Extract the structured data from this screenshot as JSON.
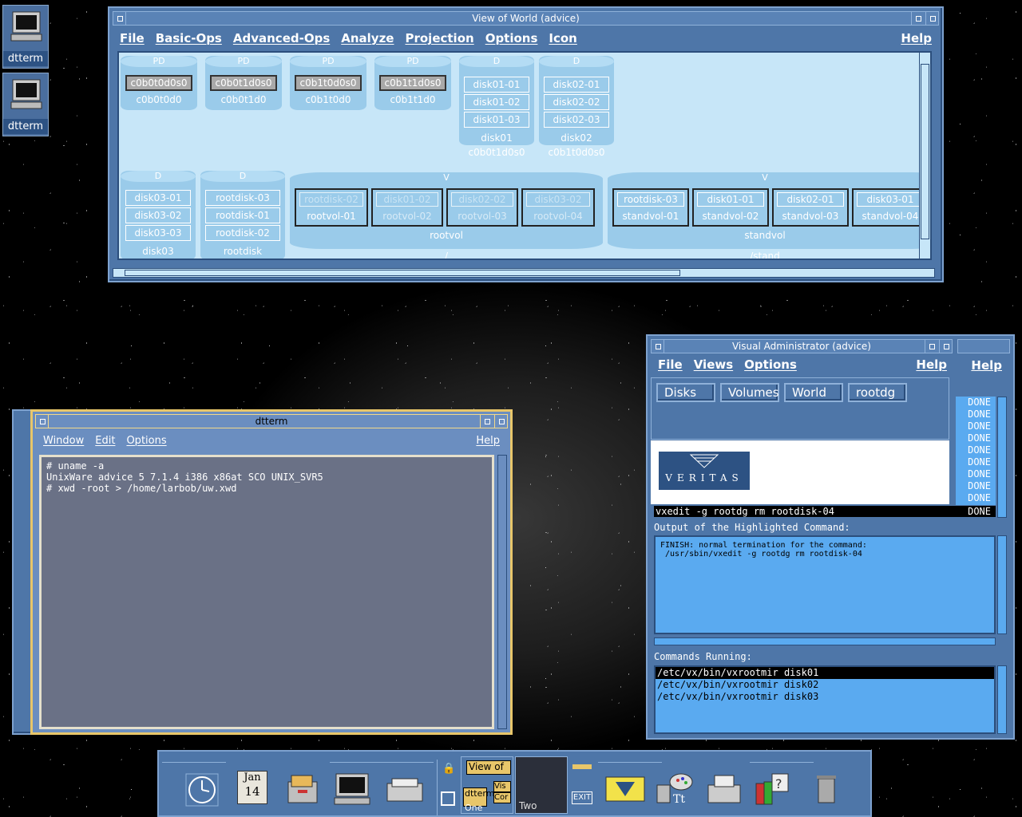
{
  "desktop": {
    "icons": [
      {
        "label": "dtterm",
        "icon": "terminal-icon"
      },
      {
        "label": "dtterm",
        "icon": "terminal-icon"
      }
    ]
  },
  "world_window": {
    "title": "View of World (advice)",
    "menu": [
      "File",
      "Basic-Ops",
      "Advanced-Ops",
      "Analyze",
      "Projection",
      "Options",
      "Icon"
    ],
    "help": "Help",
    "physical_disks": [
      {
        "type": "PD",
        "sub": "c0b0t0d0s0",
        "name": "c0b0t0d0"
      },
      {
        "type": "PD",
        "sub": "c0b0t1d0s0",
        "name": "c0b0t1d0"
      },
      {
        "type": "PD",
        "sub": "c0b1t0d0s0",
        "name": "c0b1t0d0"
      },
      {
        "type": "PD",
        "sub": "c0b1t1d0s0",
        "name": "c0b1t1d0"
      }
    ],
    "vm_disks_top": [
      {
        "type": "D",
        "subdisks": [
          "disk01-01",
          "disk01-02",
          "disk01-03"
        ],
        "name": "disk01",
        "device": "c0b0t1d0s0"
      },
      {
        "type": "D",
        "subdisks": [
          "disk02-01",
          "disk02-02",
          "disk02-03"
        ],
        "name": "disk02",
        "device": "c0b1t0d0s0"
      }
    ],
    "vm_disks_bottom": [
      {
        "type": "D",
        "subdisks": [
          "disk03-01",
          "disk03-02",
          "disk03-03"
        ],
        "name": "disk03"
      },
      {
        "type": "D",
        "subdisks": [
          "rootdisk-03",
          "rootdisk-01",
          "rootdisk-02"
        ],
        "name": "rootdisk"
      }
    ],
    "volumes": [
      {
        "type": "V",
        "name": "rootvol",
        "mount": "/",
        "plexes": [
          {
            "sd": "rootdisk-02",
            "name": "rootvol-01"
          },
          {
            "sd": "disk01-02",
            "name": "rootvol-02"
          },
          {
            "sd": "disk02-02",
            "name": "rootvol-03"
          },
          {
            "sd": "disk03-02",
            "name": "rootvol-04"
          }
        ]
      },
      {
        "type": "V",
        "name": "standvol",
        "mount": "/stand",
        "plexes": [
          {
            "sd": "rootdisk-03",
            "name": "standvol-01"
          },
          {
            "sd": "disk01-01",
            "name": "standvol-02"
          },
          {
            "sd": "disk02-01",
            "name": "standvol-03"
          },
          {
            "sd": "disk03-01",
            "name": "standvol-04"
          }
        ]
      }
    ]
  },
  "dtterm_window": {
    "title": "dtterm",
    "menu": [
      "Window",
      "Edit",
      "Options"
    ],
    "help": "Help",
    "lines": [
      "# uname -a",
      "UnixWare advice 5 7.1.4 i386 x86at SCO UNIX_SVR5",
      "# xwd -root > /home/larbob/uw.xwd"
    ]
  },
  "vxa_window": {
    "title": "Visual Administrator (advice)",
    "menu": [
      "File",
      "Views",
      "Options"
    ],
    "help": "Help",
    "back_help": "Help",
    "buttons": [
      "Disks",
      "Volumes",
      "World",
      "rootdg"
    ],
    "logo": "VERITAS",
    "done_items": [
      "DONE",
      "DONE",
      "DONE",
      "DONE",
      "DONE",
      "DONE",
      "DONE",
      "DONE",
      "DONE"
    ],
    "highlighted_command": "vxedit -g rootdg rm rootdisk-04",
    "highlighted_status": "DONE",
    "output_label": "Output of the Highlighted Command:",
    "output_lines": [
      "FINISH: normal termination for the command:",
      " /usr/sbin/vxedit -g rootdg rm rootdisk-04"
    ],
    "running_label": "Commands Running:",
    "running": [
      "/etc/vx/bin/vxrootmir disk01",
      "/etc/vx/bin/vxrootmir disk02",
      "/etc/vx/bin/vxrootmir disk03"
    ]
  },
  "front_panel": {
    "calendar_month": "Jan",
    "calendar_day": "14",
    "workspaces": [
      "View of",
      "dtterm",
      "Vis",
      "Cor",
      "One",
      "Two"
    ],
    "exit_label": "EXIT"
  }
}
